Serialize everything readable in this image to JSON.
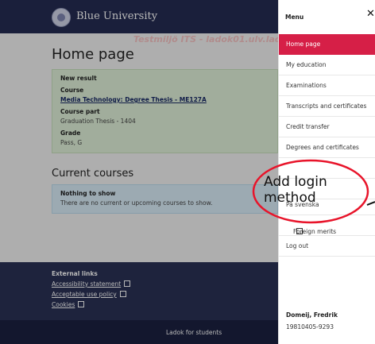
{
  "header": {
    "brand": "Blue University"
  },
  "watermark": "Testmiljö ITS - ladok01.ulv.ladok.se",
  "main": {
    "title": "Home page",
    "new_result": {
      "heading": "New result",
      "course_label": "Course",
      "course_link": "Media Technology: Degree Thesis - ME127A",
      "part_label": "Course part",
      "part_value": "Graduation Thesis - 1404",
      "grade_label": "Grade",
      "grade_value": "Pass, G"
    },
    "current_courses": {
      "title": "Current courses",
      "empty_heading": "Nothing to show",
      "empty_text": "There are no current or upcoming courses to show."
    }
  },
  "footer": {
    "title": "External links",
    "links": [
      "Accessibility statement",
      "Acceptable use policy",
      "Cookies"
    ],
    "bottom": "Ladok for students"
  },
  "menu": {
    "title": "Menu",
    "close": "✕",
    "items": [
      "Home page",
      "My education",
      "Examinations",
      "Transcripts and certificates",
      "Credit transfer",
      "Degrees and certificates",
      "",
      "",
      "På svenska",
      "Foreign merits",
      "Log out"
    ],
    "user_name": "Domeij, Fredrik",
    "user_id": "19810405-9293"
  },
  "callout": {
    "line1": "Add login",
    "line2": "method",
    "color": "#e8142a"
  }
}
